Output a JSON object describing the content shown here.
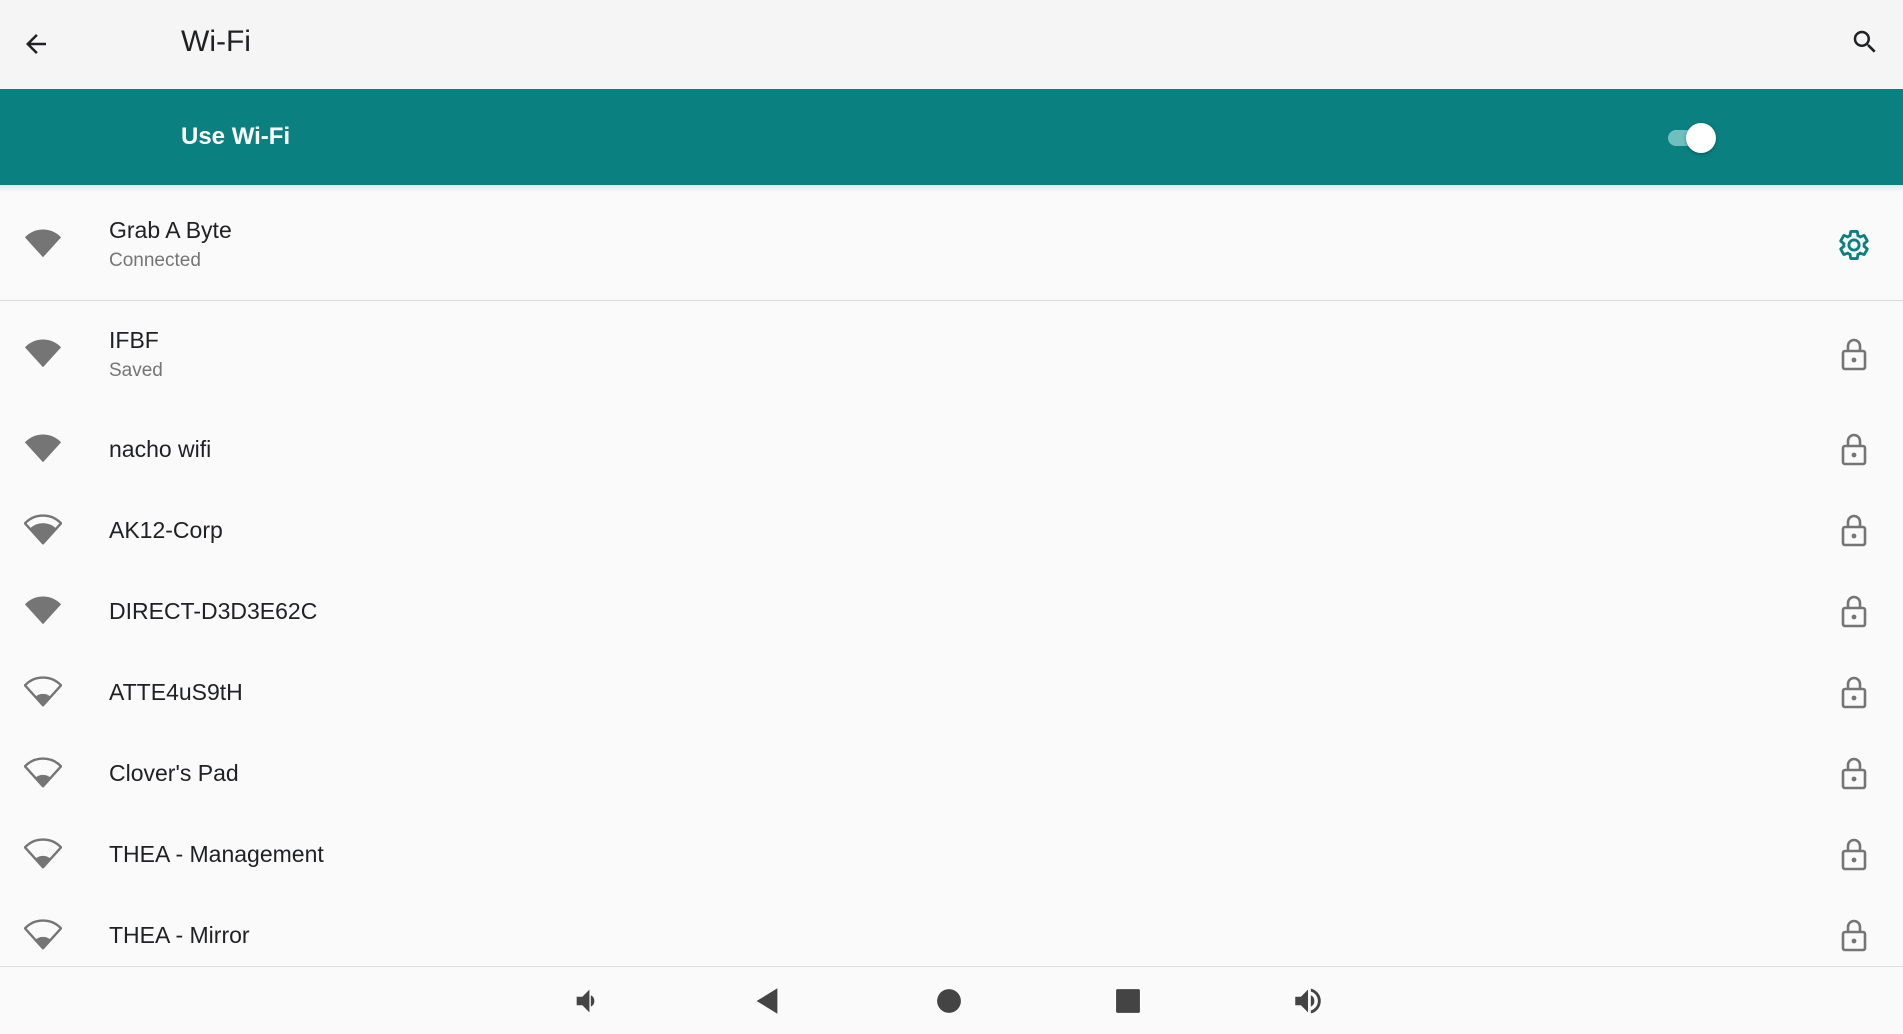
{
  "header": {
    "title": "Wi-Fi",
    "back_icon": "arrow-left-icon",
    "search_icon": "search-icon"
  },
  "master_switch": {
    "label": "Use Wi-Fi",
    "enabled": true
  },
  "networks": [
    {
      "name": "Grab A Byte",
      "status": "Connected",
      "signal": "full",
      "trailing": "gear-icon"
    },
    {
      "name": "IFBF",
      "status": "Saved",
      "signal": "full",
      "trailing": "lock-icon"
    },
    {
      "name": "nacho wifi",
      "status": "",
      "signal": "full",
      "trailing": "lock-icon"
    },
    {
      "name": "AK12-Corp",
      "status": "",
      "signal": "medium",
      "trailing": "lock-icon"
    },
    {
      "name": "DIRECT-D3D3E62C",
      "status": "",
      "signal": "full",
      "trailing": "lock-icon"
    },
    {
      "name": "ATTE4uS9tH",
      "status": "",
      "signal": "low",
      "trailing": "lock-icon"
    },
    {
      "name": "Clover's Pad",
      "status": "",
      "signal": "low",
      "trailing": "lock-icon"
    },
    {
      "name": "THEA - Management",
      "status": "",
      "signal": "low",
      "trailing": "lock-icon"
    },
    {
      "name": "THEA - Mirror",
      "status": "",
      "signal": "low",
      "trailing": "lock-icon"
    }
  ],
  "navbar": {
    "items": [
      "volume-down-icon",
      "back-triangle-icon",
      "home-circle-icon",
      "recents-square-icon",
      "volume-up-icon"
    ]
  },
  "colors": {
    "accent": "#0a8080",
    "icon_gray": "#757575",
    "background": "#fafafa"
  }
}
